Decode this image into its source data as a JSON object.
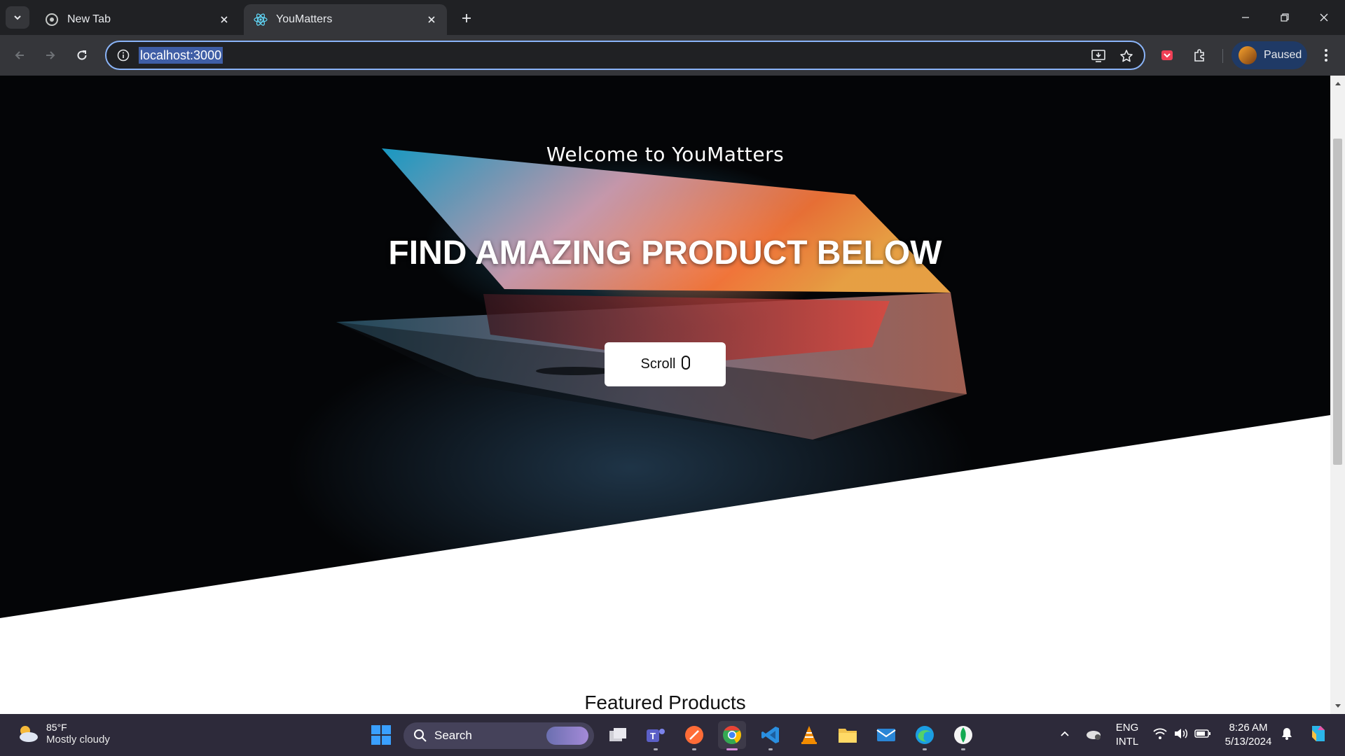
{
  "browser": {
    "tabs": [
      {
        "title": "New Tab",
        "favicon": "chrome-icon",
        "active": false
      },
      {
        "title": "YouMatters",
        "favicon": "react-icon",
        "active": true
      }
    ],
    "url": "localhost:3000",
    "profile_label": "Paused",
    "accent_color": "#8ab4f8"
  },
  "hero": {
    "welcome": "Welcome to YouMatters",
    "headline": "FIND AMAZING PRODUCT BELOW",
    "scroll_button_label": "Scroll",
    "scroll_button_icon": "mouse-icon"
  },
  "featured": {
    "title": "Featured Products"
  },
  "taskbar": {
    "weather_temp": "85°F",
    "weather_condition": "Mostly cloudy",
    "search_placeholder": "Search",
    "apps": [
      "start-icon",
      "task-view-icon",
      "teams-icon",
      "postman-icon",
      "chrome-icon",
      "vscode-icon",
      "vlc-icon",
      "file-explorer-icon",
      "mail-icon",
      "edge-icon",
      "mongodb-icon"
    ],
    "language_line1": "ENG",
    "language_line2": "INTL",
    "time": "8:26 AM",
    "date": "5/13/2024"
  }
}
